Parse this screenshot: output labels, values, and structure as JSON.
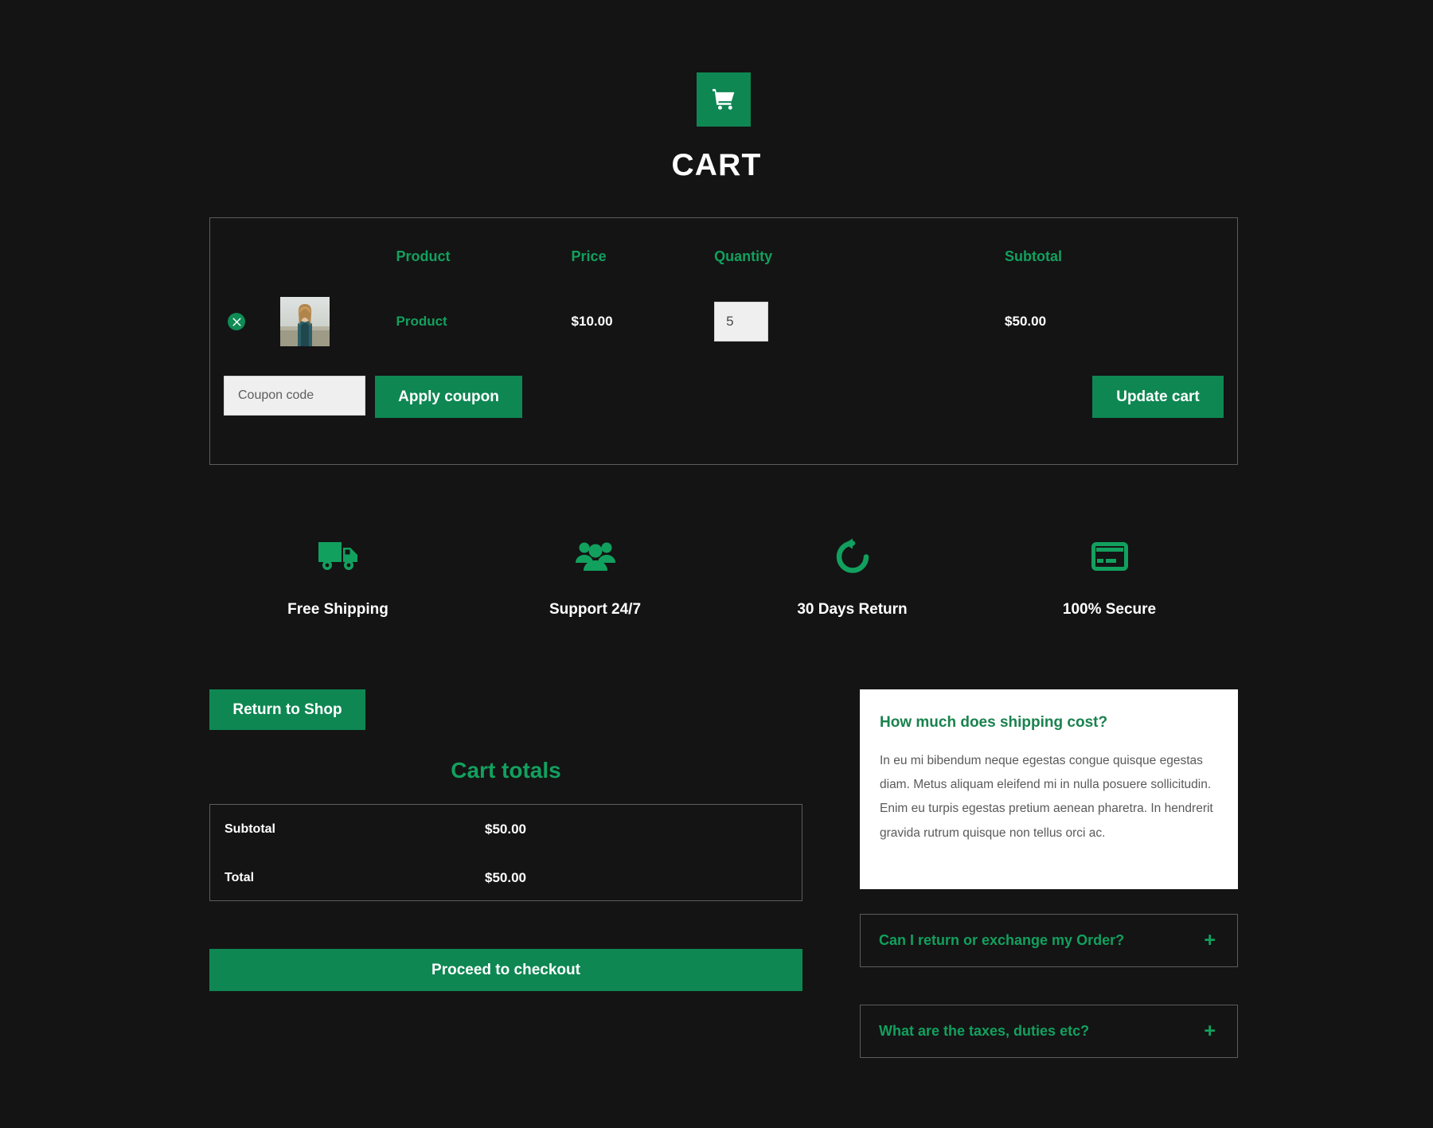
{
  "theme": {
    "background": "#141414",
    "accent_green": "#0e8753",
    "accent_green_text": "#12a05e",
    "text_light": "#ffffff"
  },
  "header": {
    "cart_icon": "shopping-cart-icon",
    "title": "CART"
  },
  "cart_table": {
    "columns": [
      "",
      "",
      "Product",
      "Price",
      "Quantity",
      "Subtotal"
    ],
    "headers": {
      "product": "Product",
      "price": "Price",
      "quantity": "Quantity",
      "subtotal": "Subtotal"
    },
    "rows": [
      {
        "remove_icon": "close-circle-icon",
        "thumbnail": "product-photo-woman-outdoors",
        "name": "Product",
        "price": "$10.00",
        "quantity": "5",
        "subtotal": "$50.00"
      }
    ],
    "coupon": {
      "placeholder": "Coupon code",
      "value": "",
      "apply_label": "Apply coupon"
    },
    "update_label": "Update cart"
  },
  "features": [
    {
      "icon": "truck-icon",
      "label": "Free Shipping"
    },
    {
      "icon": "people-group-icon",
      "label": "Support 24/7"
    },
    {
      "icon": "undo-arrow-icon",
      "label": "30 Days Return"
    },
    {
      "icon": "credit-card-icon",
      "label": "100% Secure"
    }
  ],
  "totals": {
    "return_to_shop_label": "Return to Shop",
    "title": "Cart totals",
    "rows": [
      {
        "label": "Subtotal",
        "value": "$50.00"
      },
      {
        "label": "Total",
        "value": "$50.00"
      }
    ],
    "checkout_label": "Proceed to checkout"
  },
  "faq": {
    "open_item": {
      "question": "How much does shipping cost?",
      "answer": "In eu mi bibendum neque egestas congue quisque egestas diam. Metus aliquam eleifend mi in nulla posuere sollicitudin. Enim eu turpis egestas pretium aenean pharetra. In hendrerit gravida rutrum quisque non tellus orci ac."
    },
    "collapsed_items": [
      {
        "question": "Can I return or exchange my Order?",
        "toggle": "+"
      },
      {
        "question": "What are the taxes, duties etc?",
        "toggle": "+"
      }
    ]
  }
}
